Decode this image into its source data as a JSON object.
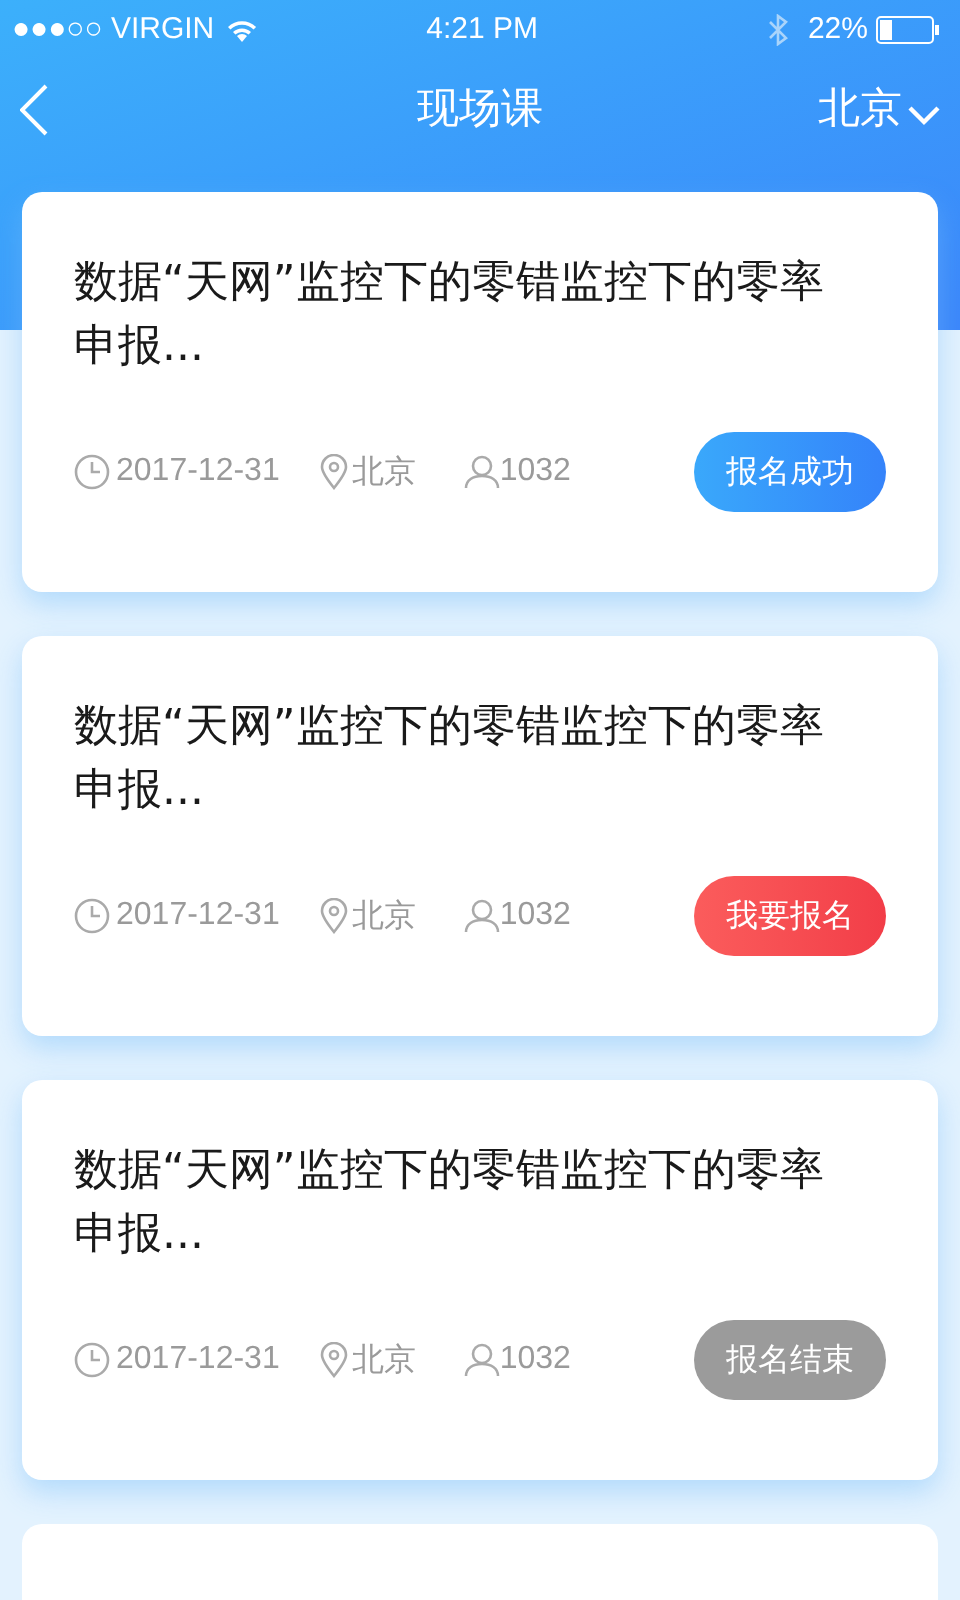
{
  "status_bar": {
    "carrier": "●●●○○ VIRGIN",
    "time": "4:21 PM",
    "battery": "22%"
  },
  "nav": {
    "title": "现场课",
    "city": "北京"
  },
  "courses": [
    {
      "title": "数据“天网”监控下的零错监控下的零率申报...",
      "date": "2017-12-31",
      "location": "北京",
      "count": "1032",
      "button": {
        "label": "报名成功",
        "kind": "success"
      }
    },
    {
      "title": "数据“天网”监控下的零错监控下的零率申报...",
      "date": "2017-12-31",
      "location": "北京",
      "count": "1032",
      "button": {
        "label": "我要报名",
        "kind": "open"
      }
    },
    {
      "title": "数据“天网”监控下的零错监控下的零率申报...",
      "date": "2017-12-31",
      "location": "北京",
      "count": "1032",
      "button": {
        "label": "报名结束",
        "kind": "ended"
      }
    }
  ],
  "more_below": true
}
